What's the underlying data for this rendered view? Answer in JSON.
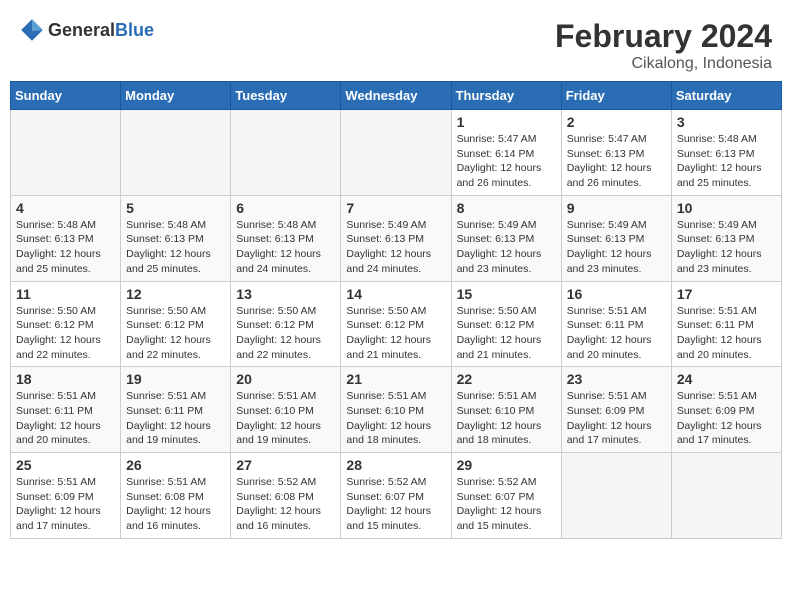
{
  "header": {
    "logo_general": "General",
    "logo_blue": "Blue",
    "month_year": "February 2024",
    "location": "Cikalong, Indonesia"
  },
  "days_of_week": [
    "Sunday",
    "Monday",
    "Tuesday",
    "Wednesday",
    "Thursday",
    "Friday",
    "Saturday"
  ],
  "weeks": [
    [
      {
        "day": "",
        "info": ""
      },
      {
        "day": "",
        "info": ""
      },
      {
        "day": "",
        "info": ""
      },
      {
        "day": "",
        "info": ""
      },
      {
        "day": "1",
        "info": "Sunrise: 5:47 AM\nSunset: 6:14 PM\nDaylight: 12 hours and 26 minutes."
      },
      {
        "day": "2",
        "info": "Sunrise: 5:47 AM\nSunset: 6:13 PM\nDaylight: 12 hours and 26 minutes."
      },
      {
        "day": "3",
        "info": "Sunrise: 5:48 AM\nSunset: 6:13 PM\nDaylight: 12 hours and 25 minutes."
      }
    ],
    [
      {
        "day": "4",
        "info": "Sunrise: 5:48 AM\nSunset: 6:13 PM\nDaylight: 12 hours and 25 minutes."
      },
      {
        "day": "5",
        "info": "Sunrise: 5:48 AM\nSunset: 6:13 PM\nDaylight: 12 hours and 25 minutes."
      },
      {
        "day": "6",
        "info": "Sunrise: 5:48 AM\nSunset: 6:13 PM\nDaylight: 12 hours and 24 minutes."
      },
      {
        "day": "7",
        "info": "Sunrise: 5:49 AM\nSunset: 6:13 PM\nDaylight: 12 hours and 24 minutes."
      },
      {
        "day": "8",
        "info": "Sunrise: 5:49 AM\nSunset: 6:13 PM\nDaylight: 12 hours and 23 minutes."
      },
      {
        "day": "9",
        "info": "Sunrise: 5:49 AM\nSunset: 6:13 PM\nDaylight: 12 hours and 23 minutes."
      },
      {
        "day": "10",
        "info": "Sunrise: 5:49 AM\nSunset: 6:13 PM\nDaylight: 12 hours and 23 minutes."
      }
    ],
    [
      {
        "day": "11",
        "info": "Sunrise: 5:50 AM\nSunset: 6:12 PM\nDaylight: 12 hours and 22 minutes."
      },
      {
        "day": "12",
        "info": "Sunrise: 5:50 AM\nSunset: 6:12 PM\nDaylight: 12 hours and 22 minutes."
      },
      {
        "day": "13",
        "info": "Sunrise: 5:50 AM\nSunset: 6:12 PM\nDaylight: 12 hours and 22 minutes."
      },
      {
        "day": "14",
        "info": "Sunrise: 5:50 AM\nSunset: 6:12 PM\nDaylight: 12 hours and 21 minutes."
      },
      {
        "day": "15",
        "info": "Sunrise: 5:50 AM\nSunset: 6:12 PM\nDaylight: 12 hours and 21 minutes."
      },
      {
        "day": "16",
        "info": "Sunrise: 5:51 AM\nSunset: 6:11 PM\nDaylight: 12 hours and 20 minutes."
      },
      {
        "day": "17",
        "info": "Sunrise: 5:51 AM\nSunset: 6:11 PM\nDaylight: 12 hours and 20 minutes."
      }
    ],
    [
      {
        "day": "18",
        "info": "Sunrise: 5:51 AM\nSunset: 6:11 PM\nDaylight: 12 hours and 20 minutes."
      },
      {
        "day": "19",
        "info": "Sunrise: 5:51 AM\nSunset: 6:11 PM\nDaylight: 12 hours and 19 minutes."
      },
      {
        "day": "20",
        "info": "Sunrise: 5:51 AM\nSunset: 6:10 PM\nDaylight: 12 hours and 19 minutes."
      },
      {
        "day": "21",
        "info": "Sunrise: 5:51 AM\nSunset: 6:10 PM\nDaylight: 12 hours and 18 minutes."
      },
      {
        "day": "22",
        "info": "Sunrise: 5:51 AM\nSunset: 6:10 PM\nDaylight: 12 hours and 18 minutes."
      },
      {
        "day": "23",
        "info": "Sunrise: 5:51 AM\nSunset: 6:09 PM\nDaylight: 12 hours and 17 minutes."
      },
      {
        "day": "24",
        "info": "Sunrise: 5:51 AM\nSunset: 6:09 PM\nDaylight: 12 hours and 17 minutes."
      }
    ],
    [
      {
        "day": "25",
        "info": "Sunrise: 5:51 AM\nSunset: 6:09 PM\nDaylight: 12 hours and 17 minutes."
      },
      {
        "day": "26",
        "info": "Sunrise: 5:51 AM\nSunset: 6:08 PM\nDaylight: 12 hours and 16 minutes."
      },
      {
        "day": "27",
        "info": "Sunrise: 5:52 AM\nSunset: 6:08 PM\nDaylight: 12 hours and 16 minutes."
      },
      {
        "day": "28",
        "info": "Sunrise: 5:52 AM\nSunset: 6:07 PM\nDaylight: 12 hours and 15 minutes."
      },
      {
        "day": "29",
        "info": "Sunrise: 5:52 AM\nSunset: 6:07 PM\nDaylight: 12 hours and 15 minutes."
      },
      {
        "day": "",
        "info": ""
      },
      {
        "day": "",
        "info": ""
      }
    ]
  ]
}
